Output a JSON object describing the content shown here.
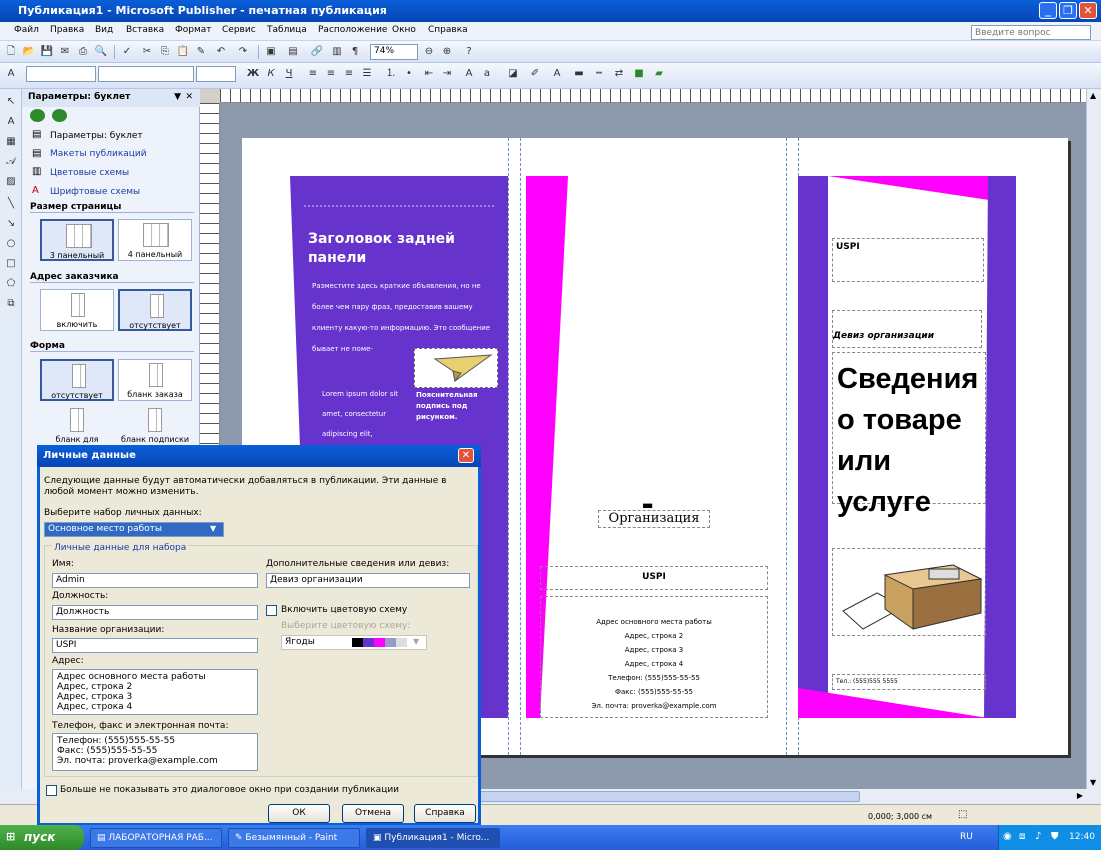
{
  "window": {
    "title": "Публикация1 - Microsoft Publisher - печатная публикация"
  },
  "menu": [
    "Файл",
    "Правка",
    "Вид",
    "Вставка",
    "Формат",
    "Сервис",
    "Таблица",
    "Расположение",
    "Окно",
    "Справка"
  ],
  "help_placeholder": "Введите вопрос",
  "toolbar": {
    "zoom": "74%"
  },
  "taskpane": {
    "title": "Параметры: буклет",
    "links": [
      "Параметры: буклет",
      "Макеты публикаций",
      "Цветовые схемы",
      "Шрифтовые схемы"
    ],
    "page_size_title": "Размер страницы",
    "page_size": [
      "3 панельный",
      "4 панельный"
    ],
    "address_title": "Адрес заказчика",
    "address": [
      "включить",
      "отсутствует"
    ],
    "form_title": "Форма",
    "form": [
      "отсутствует",
      "бланк заказа",
      "бланк для ответов",
      "бланк подписки"
    ]
  },
  "brochure": {
    "back_title": "Заголовок задней панели",
    "back_text": "Разместите здесь краткие объявления, но не более чем пару фраз, предоставив вашему клиенту какую-то информацию. Это сообщение бывает не поме-",
    "lorem": "Lorem ipsum dolor sit amet, consectetur adipiscing elit,",
    "caption": "Пояснительная подпись под рисунком.",
    "org_logo": "Организация",
    "org_name": "USPI",
    "address_lines": [
      "Адрес основного места работы",
      "Адрес, строка 2",
      "Адрес, строка 3",
      "Адрес, строка 4",
      "Телефон: (555)555-55-55",
      "Факс: (555)555-55-55",
      "Эл. почта: proverka@example.com"
    ],
    "right_org": "USPI",
    "motto": "Девиз организации",
    "headline": "Сведения о товаре или услуге",
    "tel": "Тел.: (555)555 5555"
  },
  "dialog": {
    "title": "Личные данные",
    "intro": "Следующие данные будут автоматически добавляться в публикации. Эти данные в любой момент можно изменить.",
    "select_label": "Выберите набор личных данных:",
    "select_value": "Основное место работы",
    "group_title": "Личные данные для набора",
    "name_label": "Имя:",
    "name_value": "Admin",
    "position_label": "Должность:",
    "position_value": "Должность",
    "org_label": "Название организации:",
    "org_value": "USPI",
    "address_label": "Адрес:",
    "address_value": [
      "Адрес основного места работы",
      "Адрес, строка 2",
      "Адрес, строка 3",
      "Адрес, строка 4"
    ],
    "contact_label": "Телефон, факс и электронная почта:",
    "contact_value": [
      "Телефон: (555)555-55-55",
      "Факс: (555)555-55-55",
      "Эл. почта: proverka@example.com"
    ],
    "extra_label": "Дополнительные сведения или девиз:",
    "extra_value": "Девиз организации",
    "color_check": "Включить цветовую схему",
    "color_label": "Выберите цветовую схему:",
    "color_value": "Ягоды",
    "dont_show": "Больше не показывать это диалоговое окно при создании публикации",
    "ok": "ОК",
    "cancel": "Отмена",
    "help": "Справка"
  },
  "statusbar": {
    "coords": "0,000; 3,000 см"
  },
  "taskbar": {
    "start": "пуск",
    "tasks": [
      "ЛАБОРАТОРНАЯ РАБ...",
      "Безымянный - Paint",
      "Публикация1 - Micro..."
    ],
    "lang": "RU",
    "time": "12:40"
  }
}
